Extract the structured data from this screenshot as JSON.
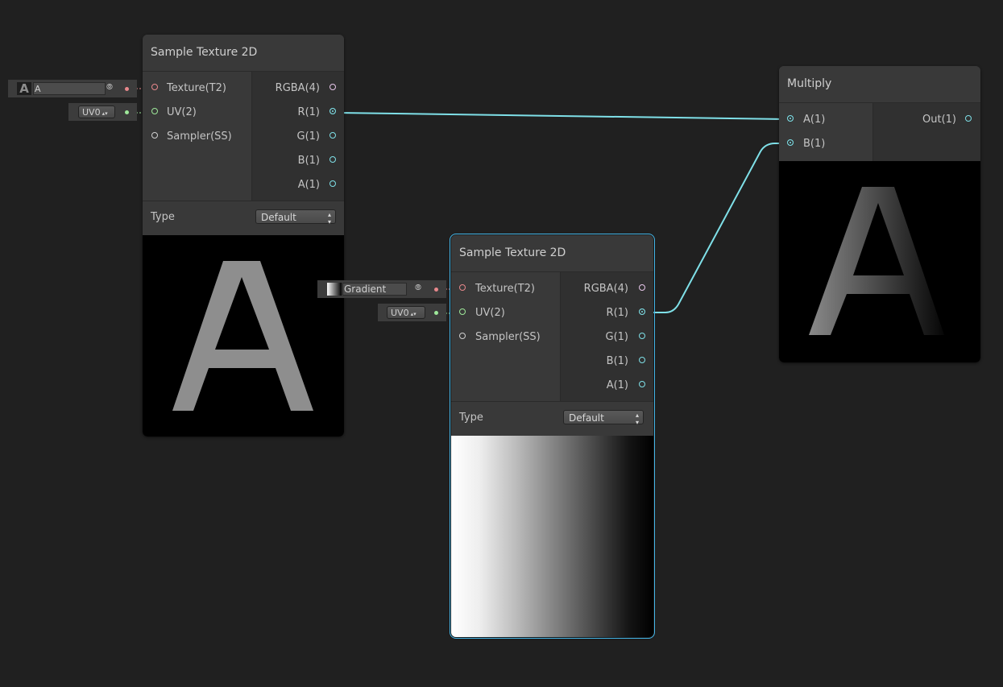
{
  "node1": {
    "title": "Sample Texture 2D",
    "inputs": [
      "Texture(T2)",
      "UV(2)",
      "Sampler(SS)"
    ],
    "outputs": [
      "RGBA(4)",
      "R(1)",
      "G(1)",
      "B(1)",
      "A(1)"
    ],
    "type_label": "Type",
    "type_value": "Default",
    "texture_field": "A",
    "uv_value": "UV0",
    "preview_letter": "A"
  },
  "node2": {
    "title": "Sample Texture 2D",
    "inputs": [
      "Texture(T2)",
      "UV(2)",
      "Sampler(SS)"
    ],
    "outputs": [
      "RGBA(4)",
      "R(1)",
      "G(1)",
      "B(1)",
      "A(1)"
    ],
    "type_label": "Type",
    "type_value": "Default",
    "texture_field": "Gradient",
    "uv_value": "UV0"
  },
  "node3": {
    "title": "Multiply",
    "inputs": [
      "A(1)",
      "B(1)"
    ],
    "outputs": [
      "Out(1)"
    ],
    "preview_letter": "A"
  },
  "colors": {
    "background": "#202020",
    "edge": "#7fe0e8",
    "selection": "#44b6e8",
    "texture_port": "#e8888c",
    "uv_port": "#9ee89a",
    "float_port": "#7fe0e8",
    "vector4_port": "#e7c6ea"
  }
}
